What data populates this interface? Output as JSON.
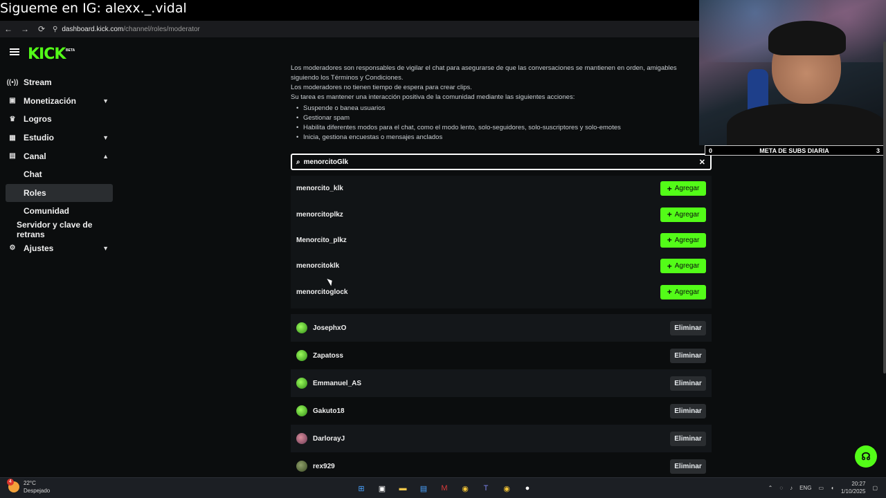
{
  "overlay_text": "Sigueme en IG: alexx._.vidal",
  "browser": {
    "back_icon": "←",
    "forward_icon": "→",
    "reload_icon": "⟳",
    "url_host": "dashboard.kick.com",
    "url_path": "/channel/roles/moderator"
  },
  "sidebar": {
    "logo": "KICK",
    "logo_badge": "BETA",
    "items": [
      {
        "label": "Stream",
        "icon": "((•))"
      },
      {
        "label": "Monetización",
        "icon": "▣",
        "chevron": "⌄"
      },
      {
        "label": "Logros",
        "icon": "🏆"
      },
      {
        "label": "Estudio",
        "icon": "▦",
        "chevron": "⌄"
      },
      {
        "label": "Canal",
        "icon": "▤",
        "chevron": "⌃"
      },
      {
        "label": "Chat"
      },
      {
        "label": "Roles"
      },
      {
        "label": "Comunidad"
      },
      {
        "label": "Servidor y clave de retrans"
      },
      {
        "label": "Ajustes",
        "icon": "⚙",
        "chevron": "⌄"
      }
    ]
  },
  "description": {
    "line1": "Los moderadores son responsables de vigilar el chat para asegurarse de que las conversaciones se mantienen en orden, amigables",
    "line2": "siguiendo los Términos y Condiciones.",
    "line3": "Los moderadores no tienen tiempo de espera para crear clips.",
    "line4": "Su tarea es mantener una interacción positiva de la comunidad mediante las siguientes acciones:",
    "bullets": [
      "Suspende o banea usuarios",
      "Gestionar spam",
      "Habilita diferentes modos para el chat, como el modo lento, solo-seguidores, solo-suscriptores y solo-emotes",
      "Inicia, gestiona encuestas o mensajes anclados"
    ]
  },
  "search": {
    "value": "menorcitoGlk",
    "clear_icon": "✕",
    "search_icon": "⌕"
  },
  "results": {
    "add_label": "Agregar",
    "users": [
      "menorcito_klk",
      "menorcitoplkz",
      "Menorcito_plkz",
      "menorcitoklk",
      "menorcitoglock"
    ]
  },
  "moderators": {
    "remove_label": "Eliminar",
    "users": [
      "JosephxO",
      "Zapatoss",
      "Emmanuel_AS",
      "Gakuto18",
      "DarlorayJ",
      "rex929"
    ]
  },
  "goal": {
    "left": "0",
    "title": "META DE SUBS DIARIA",
    "right": "3"
  },
  "taskbar": {
    "weather_temp": "22°C",
    "weather_desc": "Despejado",
    "weather_badge": "4",
    "lang": "ENG",
    "time": "20:27",
    "date": "1/10/2025"
  }
}
